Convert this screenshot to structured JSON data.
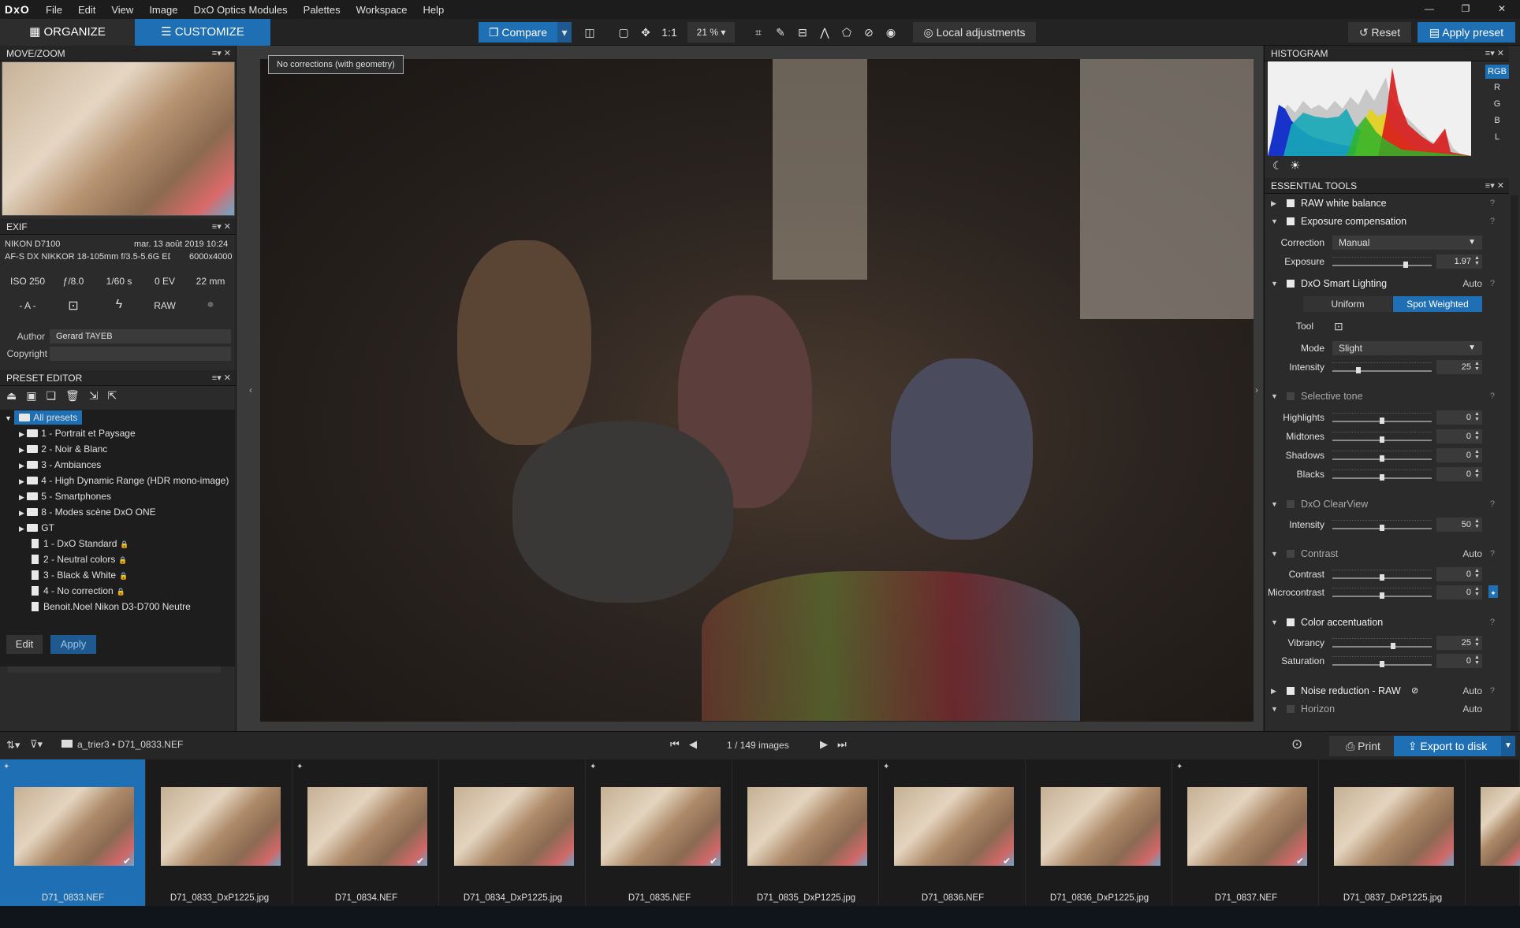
{
  "menubar": {
    "logo": "DxO",
    "items": [
      "File",
      "Edit",
      "View",
      "Image",
      "DxO Optics Modules",
      "Palettes",
      "Workspace",
      "Help"
    ],
    "win": [
      "—",
      "❐",
      "✕"
    ]
  },
  "toolbar": {
    "organize": "ORGANIZE",
    "customize": "CUSTOMIZE",
    "compare": "Compare",
    "one_to_one": "1:1",
    "zoom": "21 %",
    "local_adj": "Local adjustments",
    "reset": "Reset",
    "apply_preset": "Apply preset"
  },
  "movezoom": {
    "title": "MOVE/ZOOM"
  },
  "exif": {
    "title": "EXIF",
    "camera": "NIKON D7100",
    "date": "mar. 13 août 2019 10:24",
    "lens": "AF-S DX NIKKOR 18-105mm f/3.5-5.6G ED...",
    "size": "6000x4000",
    "iso": "ISO 250",
    "aperture": "ƒ/8.0",
    "shutter": "1/60 s",
    "ev": "0 EV",
    "focal": "22 mm",
    "mode": "- A -",
    "raw": "RAW",
    "author_label": "Author",
    "author": "Gerard TAYEB",
    "copyright_label": "Copyright",
    "copyright": ""
  },
  "preset_editor": {
    "title": "PRESET EDITOR",
    "root": "All presets",
    "folders": [
      "1 - Portrait et Paysage",
      "2 - Noir & Blanc",
      "3 - Ambiances",
      "4 - High Dynamic Range (HDR mono-image)",
      "5 - Smartphones",
      "8 - Modes scène DxO ONE",
      "GT"
    ],
    "presets": [
      "1 - DxO Standard",
      "2 - Neutral colors",
      "3 - Black & White",
      "4 - No correction",
      "Benoit.Noel Nikon D3-D700 Neutre"
    ],
    "edit": "Edit",
    "apply": "Apply"
  },
  "viewer": {
    "badge": "No corrections (with geometry)"
  },
  "histogram": {
    "title": "HISTOGRAM",
    "channels": [
      "RGB",
      "R",
      "G",
      "B",
      "L"
    ]
  },
  "essential": {
    "title": "ESSENTIAL TOOLS",
    "raw_wb": "RAW white balance",
    "exposure": {
      "name": "Exposure compensation",
      "correction_label": "Correction",
      "correction": "Manual",
      "exposure_label": "Exposure",
      "exposure_val": "1.97",
      "exposure_level": 0.75
    },
    "smart": {
      "name": "DxO Smart Lighting",
      "aux": "Auto",
      "uniform": "Uniform",
      "spot": "Spot Weighted",
      "tool_label": "Tool",
      "mode_label": "Mode",
      "mode": "Slight",
      "intensity_label": "Intensity",
      "intensity": "25",
      "intensity_level": 0.25
    },
    "selective": {
      "name": "Selective tone",
      "highlights_label": "Highlights",
      "highlights": "0",
      "midtones_label": "Midtones",
      "midtones": "0",
      "shadows_label": "Shadows",
      "shadows": "0",
      "blacks_label": "Blacks",
      "blacks": "0"
    },
    "clearview": {
      "name": "DxO ClearView",
      "intensity_label": "Intensity",
      "intensity": "50",
      "intensity_level": 0.5
    },
    "contrast": {
      "name": "Contrast",
      "aux": "Auto",
      "contrast_label": "Contrast",
      "contrast": "0",
      "micro_label": "Microcontrast",
      "micro": "0"
    },
    "color": {
      "name": "Color accentuation",
      "vibrancy_label": "Vibrancy",
      "vibrancy": "25",
      "vibrancy_level": 0.62,
      "saturation_label": "Saturation",
      "saturation": "0"
    },
    "noise": {
      "name": "Noise reduction - RAW",
      "aux": "Auto"
    },
    "horizon": {
      "name": "Horizon",
      "aux": "Auto"
    }
  },
  "filmbar": {
    "path": "a_trier3 • D71_0833.NEF",
    "counter": "1 / 149  images",
    "print": "Print",
    "export": "Export to disk"
  },
  "filmstrip": [
    "D71_0833.NEF",
    "D71_0833_DxP1225.jpg",
    "D71_0834.NEF",
    "D71_0834_DxP1225.jpg",
    "D71_0835.NEF",
    "D71_0835_DxP1225.jpg",
    "D71_0836.NEF",
    "D71_0836_DxP1225.jpg",
    "D71_0837.NEF",
    "D71_0837_DxP1225.jpg"
  ],
  "colors": {
    "accent": "#1e6fb4"
  }
}
